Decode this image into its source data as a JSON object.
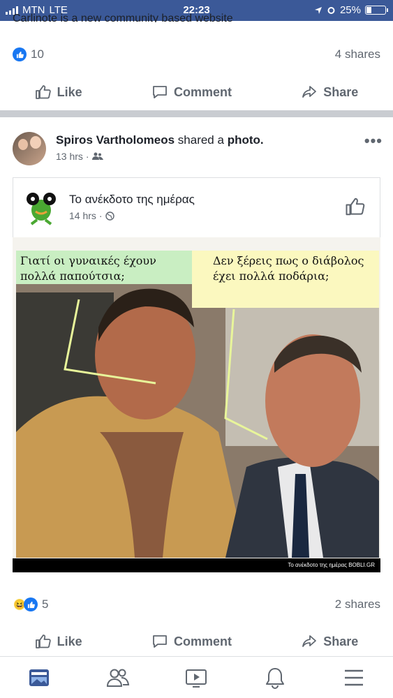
{
  "status_bar": {
    "carrier": "MTN",
    "network": "LTE",
    "time": "22:23",
    "battery": "25%",
    "battery_level": 0.25
  },
  "previous_post": {
    "cut_text": "Carlinote is a new community based website",
    "likes": "10",
    "shares": "4 shares",
    "actions": {
      "like": "Like",
      "comment": "Comment",
      "share": "Share"
    }
  },
  "post": {
    "author": "Spiros Vartholomeos",
    "verb": "shared a",
    "object": "photo.",
    "time": "13 hrs",
    "audience_icon": "friends-icon",
    "shared": {
      "page_name": "Το ανέκδοτο της ημέρας",
      "time": "14 hrs",
      "audience_icon": "globe-icon"
    },
    "photo": {
      "bubble_left": "Γιατί  οι γυναικές έχουν πολλά παπούτσια;",
      "bubble_right": "Δεν ξέρεις πως ο διάβολος έχει πολλά ποδάρια;",
      "footer": "Το ανέκδοτο της ημέρας BOBLI.GR"
    },
    "reactions_count": "5",
    "shares": "2 shares",
    "actions": {
      "like": "Like",
      "comment": "Comment",
      "share": "Share"
    }
  },
  "colors": {
    "brand": "#3b5998",
    "like_blue": "#1877f2",
    "text_secondary": "#606770"
  },
  "bottom_nav": [
    "news-feed-icon",
    "friends-icon",
    "watch-icon",
    "notifications-icon",
    "menu-icon"
  ]
}
